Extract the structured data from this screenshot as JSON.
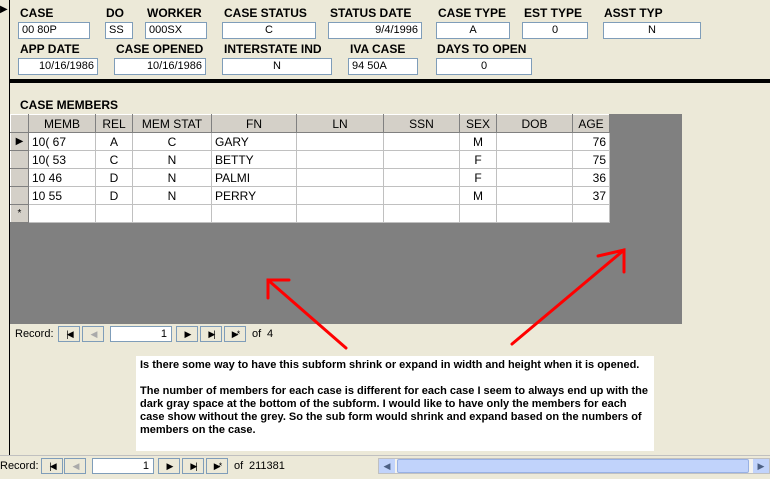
{
  "header_fields": {
    "case": {
      "label": "CASE",
      "value": "00    80P"
    },
    "do": {
      "label": "DO",
      "value": "SS"
    },
    "worker": {
      "label": "WORKER",
      "value": "000SX"
    },
    "case_status": {
      "label": "CASE STATUS",
      "value": "C"
    },
    "status_date": {
      "label": "STATUS DATE",
      "value": "9/4/1996"
    },
    "case_type": {
      "label": "CASE TYPE",
      "value": "A"
    },
    "est_type": {
      "label": "EST TYPE",
      "value": "0"
    },
    "asst_typ": {
      "label": "ASST TYP",
      "value": "N"
    },
    "app_date": {
      "label": "APP DATE",
      "value": "10/16/1986"
    },
    "case_opened": {
      "label": "CASE OPENED",
      "value": "10/16/1986"
    },
    "interstate_ind": {
      "label": "INTERSTATE IND",
      "value": "N"
    },
    "iva_case": {
      "label": "IVA CASE",
      "value": "94      50A"
    },
    "days_to_open": {
      "label": "DAYS TO OPEN",
      "value": "0"
    }
  },
  "subform": {
    "title": "CASE MEMBERS",
    "columns": [
      "MEMB",
      "REL",
      "MEM STAT",
      "FN",
      "LN",
      "SSN",
      "SEX",
      "DOB",
      "AGE"
    ],
    "rows": [
      {
        "memb": "10(      67",
        "rel": "A",
        "mem_stat": "C",
        "fn": "GARY",
        "ln": "",
        "ssn": "",
        "sex": "M",
        "dob": "",
        "age": "76"
      },
      {
        "memb": "10(      53",
        "rel": "C",
        "mem_stat": "N",
        "fn": "BETTY",
        "ln": "",
        "ssn": "",
        "sex": "F",
        "dob": "",
        "age": "75"
      },
      {
        "memb": "10       46",
        "rel": "D",
        "mem_stat": "N",
        "fn": "PALMI",
        "ln": "",
        "ssn": "",
        "sex": "F",
        "dob": "",
        "age": "36"
      },
      {
        "memb": "10       55",
        "rel": "D",
        "mem_stat": "N",
        "fn": "PERRY",
        "ln": "",
        "ssn": "",
        "sex": "M",
        "dob": "",
        "age": "37"
      }
    ],
    "current_row_marker": "▶",
    "new_row_marker": "*",
    "nav": {
      "label": "Record:",
      "current": "1",
      "of_text": "of",
      "total": "4"
    }
  },
  "note": {
    "paragraph1": "Is there some way to have this subform shrink or expand in width and height when it is opened.",
    "paragraph2": "The number of members for each case is different for each case  I seem to always end up with the dark gray space at the bottom of the subform.  I would like to have only the members for each case show without the grey.  So the sub form would shrink and expand based on the numbers of members on the case."
  },
  "main_nav": {
    "label": "Record:",
    "current": "1",
    "of_text": "of",
    "total": "211381"
  },
  "icons": {
    "first": "first-record-icon",
    "prev": "previous-record-icon",
    "next": "next-record-icon",
    "last": "last-record-icon",
    "new": "new-record-icon"
  },
  "colors": {
    "annotation_arrow": "#ff0000",
    "subform_background": "#808080",
    "form_background": "#ece9d8"
  }
}
